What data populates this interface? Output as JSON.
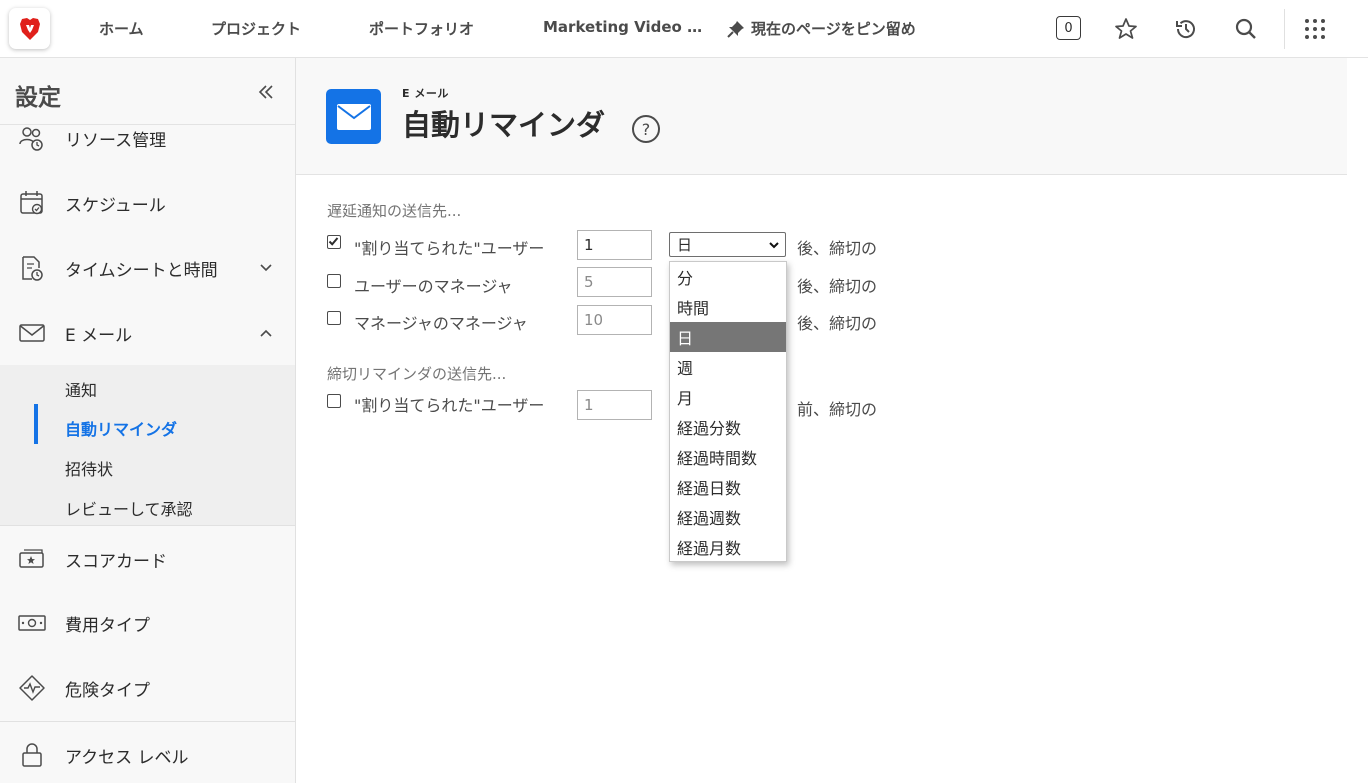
{
  "topnav": {
    "items": [
      "ホーム",
      "プロジェクト",
      "ポートフォリオ",
      "Marketing Video …"
    ],
    "pin_label": "現在のページをピン留め",
    "count": "0"
  },
  "sidebar": {
    "title": "設定",
    "items": [
      {
        "label": "リソース管理",
        "icon": "resource-icon"
      },
      {
        "label": "スケジュール",
        "icon": "calendar-icon"
      },
      {
        "label": "タイムシートと時間",
        "icon": "timesheet-icon"
      },
      {
        "label": "E メール",
        "icon": "mail-icon"
      }
    ],
    "email_subitems": [
      "通知",
      "自動リマインダ",
      "招待状",
      "レビューして承認"
    ],
    "active_subitem": "自動リマインダ",
    "items_after": [
      {
        "label": "スコアカード",
        "icon": "scorecard-icon"
      },
      {
        "label": "費用タイプ",
        "icon": "money-icon"
      },
      {
        "label": "危険タイプ",
        "icon": "risk-icon"
      },
      {
        "label": "アクセス レベル",
        "icon": "lock-icon"
      }
    ]
  },
  "header": {
    "subtitle": "E メール",
    "title": "自動リマインダ",
    "help": "?"
  },
  "overdue": {
    "label": "遅延通知の送信先...",
    "rows": [
      {
        "checked": true,
        "label": "\"割り当てられた\"ユーザー",
        "value": "1",
        "suffix": "後、締切の"
      },
      {
        "checked": false,
        "label": "ユーザーのマネージャ",
        "value": "5",
        "suffix": "後、締切の"
      },
      {
        "checked": false,
        "label": "マネージャのマネージャ",
        "value": "10",
        "suffix": "後、締切の"
      }
    ]
  },
  "reminder": {
    "label": "締切リマインダの送信先...",
    "rows": [
      {
        "checked": false,
        "label": "\"割り当てられた\"ユーザー",
        "value": "1",
        "suffix": "前、締切の"
      }
    ]
  },
  "unit_select": {
    "selected": "日",
    "options": [
      "分",
      "時間",
      "日",
      "週",
      "月",
      "経過分数",
      "経過時間数",
      "経過日数",
      "経過週数",
      "経過月数"
    ]
  },
  "colors": {
    "accent": "#1473e6",
    "logo": "#e0201b",
    "selected_option": "#767676"
  }
}
